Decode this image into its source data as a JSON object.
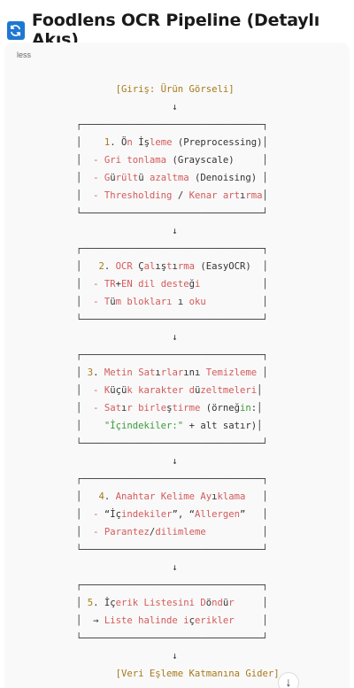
{
  "header": {
    "title": "Foodlens OCR Pipeline (Detaylı Akış)",
    "icon": "refresh-icon"
  },
  "code_block": {
    "language": "less",
    "lines": [
      [
        [
          "       [Giriş: Ürün Görseli]",
          "g"
        ]
      ],
      [
        [
          "                 ↓",
          "p"
        ]
      ],
      [
        [
          "┌────────────────────────────────┐",
          "p"
        ]
      ],
      [
        [
          "│    ",
          "p"
        ],
        [
          "1",
          "n"
        ],
        [
          ". Ö",
          "p"
        ],
        [
          "n",
          "k"
        ],
        [
          " İş",
          "p"
        ],
        [
          "leme",
          "k"
        ],
        [
          " (Preprocessing)│",
          "p"
        ]
      ],
      [
        [
          "│  ",
          "p"
        ],
        [
          "- Gri tonlama",
          "k"
        ],
        [
          " (Grayscale)     │",
          "p"
        ]
      ],
      [
        [
          "│  ",
          "p"
        ],
        [
          "- G",
          "k"
        ],
        [
          "ü",
          "p"
        ],
        [
          "rült",
          "k"
        ],
        [
          "ü",
          "p"
        ],
        [
          " azaltma",
          "k"
        ],
        [
          " (Denoising) │",
          "p"
        ]
      ],
      [
        [
          "│  ",
          "p"
        ],
        [
          "- Thresholding",
          "k"
        ],
        [
          " / ",
          "p"
        ],
        [
          "Kenar art",
          "k"
        ],
        [
          "ı",
          "p"
        ],
        [
          "rma",
          "k"
        ],
        [
          "│",
          "p"
        ]
      ],
      [
        [
          "└────────────────────────────────┘",
          "p"
        ]
      ],
      [
        [
          "                 ↓",
          "p"
        ]
      ],
      [
        [
          "┌────────────────────────────────┐",
          "p"
        ]
      ],
      [
        [
          "│   ",
          "p"
        ],
        [
          "2",
          "n"
        ],
        [
          ". ",
          "p"
        ],
        [
          "OCR",
          "k"
        ],
        [
          " Ç",
          "p"
        ],
        [
          "al",
          "k"
        ],
        [
          "ış",
          "p"
        ],
        [
          "t",
          "k"
        ],
        [
          "ı",
          "p"
        ],
        [
          "rma",
          "k"
        ],
        [
          " (EasyOCR)  │",
          "p"
        ]
      ],
      [
        [
          "│  ",
          "p"
        ],
        [
          "- TR",
          "k"
        ],
        [
          "+",
          "p"
        ],
        [
          "EN dil deste",
          "k"
        ],
        [
          "ğ",
          "p"
        ],
        [
          "i",
          "k"
        ],
        [
          "           │",
          "p"
        ]
      ],
      [
        [
          "│  ",
          "p"
        ],
        [
          "- T",
          "k"
        ],
        [
          "ü",
          "p"
        ],
        [
          "m blokları",
          "k"
        ],
        [
          " ı ",
          "p"
        ],
        [
          "oku",
          "k"
        ],
        [
          "          │",
          "p"
        ]
      ],
      [
        [
          "└────────────────────────────────┘",
          "p"
        ]
      ],
      [
        [
          "                 ↓",
          "p"
        ]
      ],
      [
        [
          "┌────────────────────────────────┐",
          "p"
        ]
      ],
      [
        [
          "│ ",
          "p"
        ],
        [
          "3",
          "n"
        ],
        [
          ". ",
          "p"
        ],
        [
          "Metin Sat",
          "k"
        ],
        [
          "ı",
          "p"
        ],
        [
          "rlar",
          "k"
        ],
        [
          "ını",
          "p"
        ],
        [
          " Temizleme",
          "k"
        ],
        [
          " │",
          "p"
        ]
      ],
      [
        [
          "│  ",
          "p"
        ],
        [
          "- K",
          "k"
        ],
        [
          "üçü",
          "p"
        ],
        [
          "k karakter d",
          "k"
        ],
        [
          "ü",
          "p"
        ],
        [
          "zeltmeleri",
          "k"
        ],
        [
          "│",
          "p"
        ]
      ],
      [
        [
          "│  ",
          "p"
        ],
        [
          "- Sat",
          "k"
        ],
        [
          "ı",
          "p"
        ],
        [
          "r birle",
          "k"
        ],
        [
          "ş",
          "p"
        ],
        [
          "tirme",
          "k"
        ],
        [
          " (örneğ",
          "p"
        ],
        [
          "in",
          "s"
        ],
        [
          ":│",
          "p"
        ]
      ],
      [
        [
          "│    ",
          "p"
        ],
        [
          "\"İçindekiler:\"",
          "s"
        ],
        [
          " + alt satır)│",
          "p"
        ]
      ],
      [
        [
          "└────────────────────────────────┘",
          "p"
        ]
      ],
      [
        [
          "                 ↓",
          "p"
        ]
      ],
      [
        [
          "┌────────────────────────────────┐",
          "p"
        ]
      ],
      [
        [
          "│   ",
          "p"
        ],
        [
          "4",
          "n"
        ],
        [
          ". ",
          "p"
        ],
        [
          "Anahtar Kelime Ay",
          "k"
        ],
        [
          "ı",
          "p"
        ],
        [
          "klama",
          "k"
        ],
        [
          "   │",
          "p"
        ]
      ],
      [
        [
          "│  ",
          "p"
        ],
        [
          "- ",
          "k"
        ],
        [
          "“İç",
          "p"
        ],
        [
          "indekiler",
          "k"
        ],
        [
          "”, “",
          "p"
        ],
        [
          "Allergen",
          "k"
        ],
        [
          "”   │",
          "p"
        ]
      ],
      [
        [
          "│  ",
          "p"
        ],
        [
          "- Parantez",
          "k"
        ],
        [
          "/",
          "p"
        ],
        [
          "dilimleme",
          "k"
        ],
        [
          "          │",
          "p"
        ]
      ],
      [
        [
          "└────────────────────────────────┘",
          "p"
        ]
      ],
      [
        [
          "                 ↓",
          "p"
        ]
      ],
      [
        [
          "┌────────────────────────────────┐",
          "p"
        ]
      ],
      [
        [
          "│ ",
          "p"
        ],
        [
          "5",
          "n"
        ],
        [
          ". İç",
          "p"
        ],
        [
          "erik Listesini D",
          "k"
        ],
        [
          "ö",
          "p"
        ],
        [
          "nd",
          "k"
        ],
        [
          "ü",
          "p"
        ],
        [
          "r",
          "k"
        ],
        [
          "     │",
          "p"
        ]
      ],
      [
        [
          "│  → ",
          "p"
        ],
        [
          "Liste halinde i",
          "k"
        ],
        [
          "ç",
          "p"
        ],
        [
          "erikler",
          "k"
        ],
        [
          "     │",
          "p"
        ]
      ],
      [
        [
          "└────────────────────────────────┘",
          "p"
        ]
      ],
      [
        [
          "                 ↓",
          "p"
        ]
      ],
      [
        [
          "       [Veri Eşleme Katmanına Gider]",
          "g"
        ]
      ]
    ]
  },
  "scroll_button": {
    "icon": "arrow-down-icon",
    "glyph": "↓"
  }
}
